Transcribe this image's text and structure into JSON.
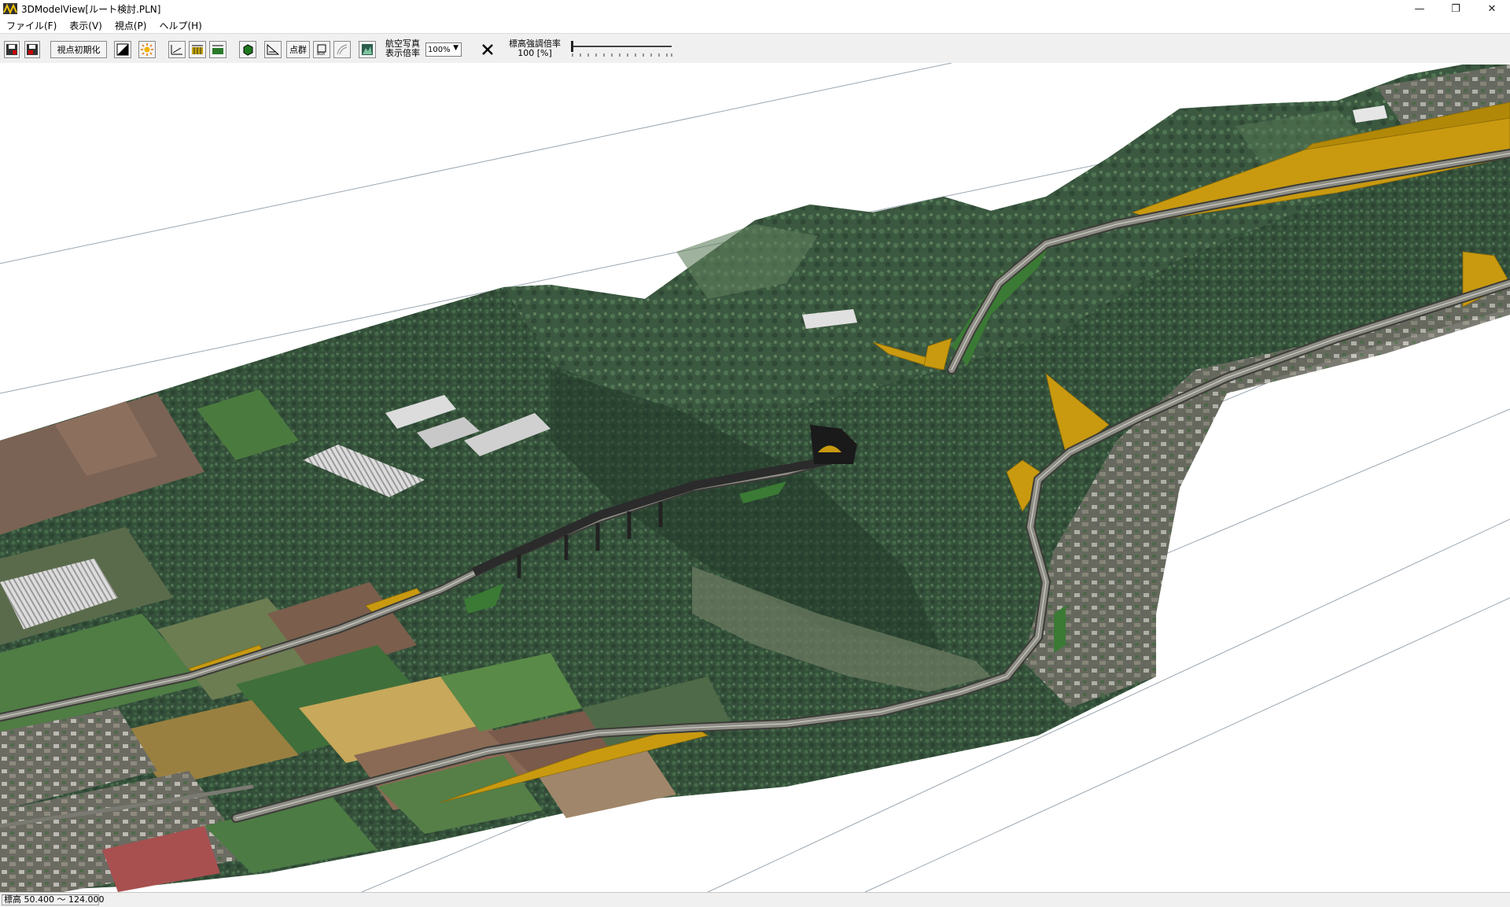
{
  "window": {
    "title": "3DModelView[ルート検討.PLN]",
    "controls": {
      "minimize": "—",
      "maximize": "❐",
      "close": "✕"
    }
  },
  "menu": [
    {
      "label": "ファイル(F)"
    },
    {
      "label": "表示(V)"
    },
    {
      "label": "視点(P)"
    },
    {
      "label": "ヘルプ(H)"
    }
  ],
  "toolbar": {
    "reset_view_label": "視点初期化",
    "point_group_label": "点群",
    "aerial_scale_label_line1": "航空写真",
    "aerial_scale_label_line2": "表示倍率",
    "aerial_scale_value": "100%",
    "height_scale_label_line1": "標高強調倍率",
    "height_scale_label_line2": "100 [%]",
    "icons": [
      "save-icon",
      "open-icon",
      "contrast-icon",
      "light-icon",
      "section-icon",
      "grid-icon",
      "terrain-icon",
      "solid-icon",
      "slope-icon",
      "box-icon",
      "curve-icon",
      "photo-icon",
      "close-x-icon"
    ]
  },
  "status": {
    "elevation_range": "標高 50.400 ～ 124.000"
  },
  "colors": {
    "cut_slope": "#c99a10",
    "road_surface": "#8e8e86",
    "grass": "#3a7a34",
    "forest_dark": "#2e4a30",
    "farm_brown": "#8a6a55"
  }
}
